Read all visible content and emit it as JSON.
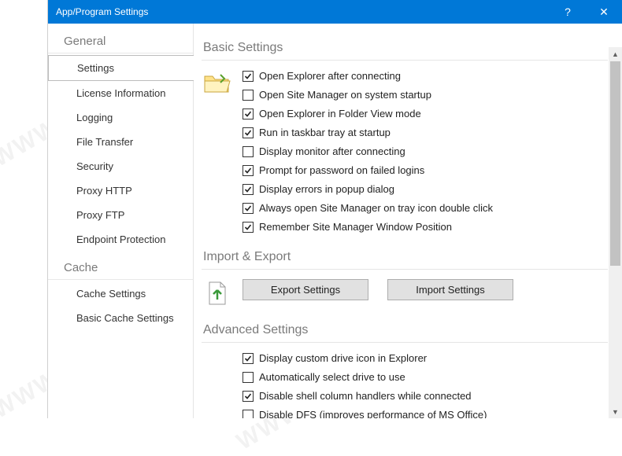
{
  "titlebar": {
    "title": "App/Program Settings",
    "help": "?",
    "close": "✕"
  },
  "sidebar": {
    "groups": [
      {
        "header": "General",
        "items": [
          {
            "label": "Settings",
            "selected": true
          },
          {
            "label": "License Information",
            "selected": false
          },
          {
            "label": "Logging",
            "selected": false
          },
          {
            "label": "File Transfer",
            "selected": false
          },
          {
            "label": "Security",
            "selected": false
          },
          {
            "label": "Proxy HTTP",
            "selected": false
          },
          {
            "label": "Proxy FTP",
            "selected": false
          },
          {
            "label": "Endpoint Protection",
            "selected": false
          }
        ]
      },
      {
        "header": "Cache",
        "items": [
          {
            "label": "Cache Settings",
            "selected": false
          },
          {
            "label": "Basic Cache Settings",
            "selected": false
          }
        ]
      }
    ]
  },
  "main": {
    "basic": {
      "title": "Basic Settings",
      "options": [
        {
          "label": "Open Explorer after connecting",
          "checked": true
        },
        {
          "label": "Open Site Manager on system startup",
          "checked": false
        },
        {
          "label": "Open Explorer in Folder View mode",
          "checked": true
        },
        {
          "label": "Run in taskbar tray at startup",
          "checked": true
        },
        {
          "label": "Display monitor after connecting",
          "checked": false
        },
        {
          "label": "Prompt for password on failed logins",
          "checked": true
        },
        {
          "label": "Display errors in popup dialog",
          "checked": true
        },
        {
          "label": "Always open Site Manager on tray icon double click",
          "checked": true
        },
        {
          "label": "Remember Site Manager Window Position",
          "checked": true
        }
      ]
    },
    "importExport": {
      "title": "Import & Export",
      "export_btn": "Export Settings",
      "import_btn": "Import Settings"
    },
    "advanced": {
      "title": "Advanced Settings",
      "options": [
        {
          "label": "Display custom drive icon in Explorer",
          "checked": true
        },
        {
          "label": "Automatically select drive to use",
          "checked": false
        },
        {
          "label": "Disable shell column handlers while connected",
          "checked": true
        },
        {
          "label": "Disable DFS (improves performance of MS Office)",
          "checked": false
        }
      ]
    }
  },
  "watermark": "WWW.WEIDOWN.COM"
}
